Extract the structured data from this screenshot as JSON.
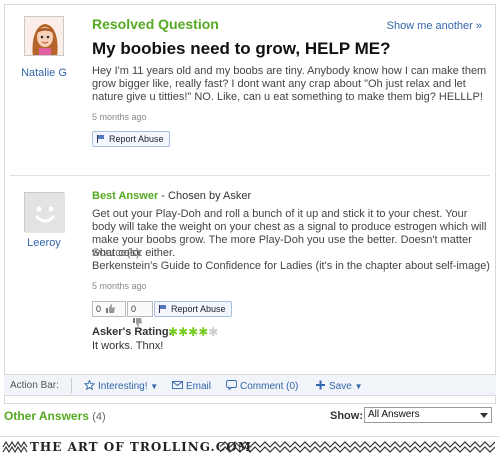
{
  "question": {
    "status": "Resolved Question",
    "show_another": "Show me another »",
    "asker_name": "Natalie G",
    "title": "My boobies need to grow, HELP ME?",
    "body": "Hey I'm 11 years old and my boobs are tiny. Anybody know how I can make them grow bigger like, really fast? I dont want any crap about \"Oh just relax and let nature give u titties!\" NO. Like, can u eat something to make them big? HELLLP!",
    "timestamp": "5 months ago",
    "report_label": "Report Abuse"
  },
  "best_answer": {
    "heading": "Best Answer",
    "chosen_by": " - Chosen by Asker",
    "answerer_name": "Leeroy",
    "body": "Get out your Play-Doh and roll a bunch of it up and stick it to your chest. Your body will take the weight on your chest as a signal to produce estrogen which will make your boobs grow. The more Play-Doh you use the better. Doesn't matter what color either.",
    "sources_label": "Source(s):",
    "sources_text": "Berkenstein's Guide to Confidence for Ladies (it's in the chapter about self-image)",
    "timestamp": "5 months ago",
    "thumbs_up_count": "0",
    "thumbs_down_count": "0",
    "report_label": "Report Abuse",
    "rating_label": "Asker's Rating:",
    "rating_stars": 4,
    "rating_max": 5,
    "rating_comment": "It works. Thnx!"
  },
  "action_bar": {
    "label": "Action Bar:",
    "interesting": "Interesting!",
    "email": "Email",
    "comment": "Comment (0)",
    "save": "Save"
  },
  "other_answers": {
    "label": "Other Answers",
    "count": "(4)",
    "show_label": "Show:",
    "show_value": "All Answers"
  },
  "watermark": {
    "text": "THE ART OF TROLLING.COM"
  },
  "colors": {
    "accent_green": "#55aa22",
    "link_blue": "#3366aa",
    "star_green": "#77cc22"
  }
}
